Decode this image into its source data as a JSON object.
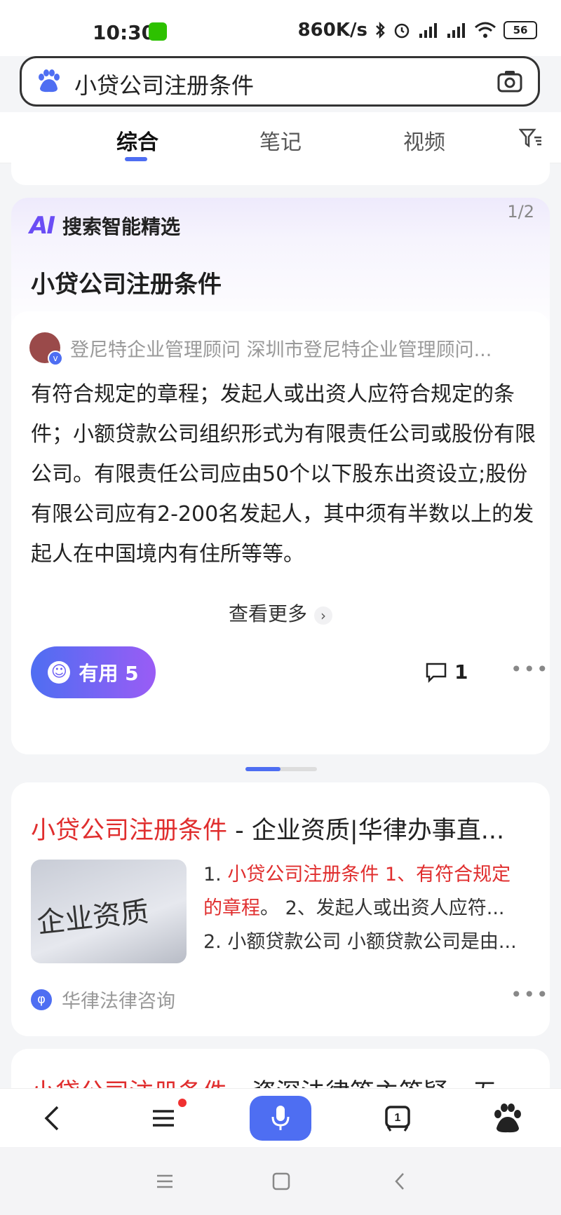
{
  "status_bar": {
    "time": "10:30",
    "speed": "860K/s",
    "battery": "56"
  },
  "search": {
    "query": "小贷公司注册条件"
  },
  "tabs": [
    {
      "label": "综合",
      "active": true
    },
    {
      "label": "笔记"
    },
    {
      "label": "视频"
    }
  ],
  "ai_card": {
    "badge_label": "搜索智能精选",
    "page_indicator": "1/2",
    "title": "小贷公司注册条件",
    "source": "登尼特企业管理顾问 深圳市登尼特企业管理顾问...",
    "body": "有符合规定的章程；发起人或出资人应符合规定的条件；小额贷款公司组织形式为有限责任公司或股份有限公司。有限责任公司应由50个以下股东出资设立;股份有限公司应有2-200名发起人，其中须有半数以上的发起人在中国境内有住所等等。",
    "more_label": "查看更多",
    "useful_label": "有用 5",
    "comment_count": "1"
  },
  "result_card": {
    "title_highlight": "小贷公司注册条件",
    "title_rest": " - 企业资质|华律办事直...",
    "thumb_text": "企业资质",
    "snippet_line1_prefix": "1. ",
    "snippet_line1_hl": "小贷公司注册条件 1、有符合规定",
    "snippet_line2_hl": "的章程",
    "snippet_line2_rest": "。 2、发起人或出资人应符...",
    "snippet_line3": "2. 小额贷款公司 小额贷款公司是由...",
    "source": "华律法律咨询"
  },
  "next_card": {
    "title_highlight": "小贷公司注册条件",
    "title_rest": " - 资深法律答主答疑 - 五"
  },
  "colors": {
    "accent": "#4e6ef2",
    "highlight": "#e02e2e"
  }
}
